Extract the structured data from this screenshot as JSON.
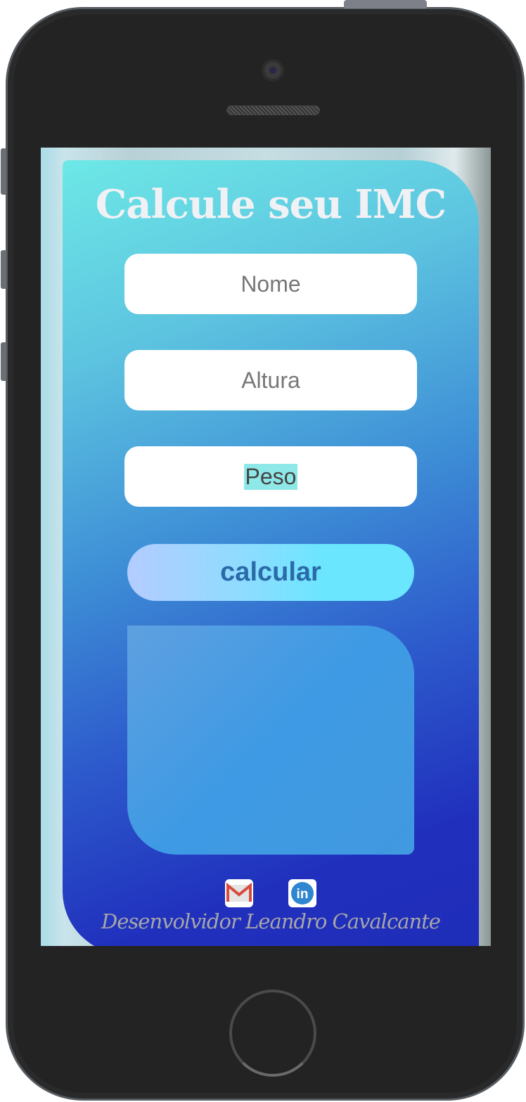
{
  "app": {
    "title": "Calcule seu IMC"
  },
  "form": {
    "name_placeholder": "Nome",
    "height_placeholder": "Altura",
    "weight_placeholder": "Peso",
    "submit_label": "calcular"
  },
  "result": {
    "text": ""
  },
  "footer": {
    "credit": "Desenvolvidor Leandro Cavalcante",
    "links": [
      {
        "icon": "gmail-icon"
      },
      {
        "icon": "linkedin-icon"
      }
    ]
  },
  "colors": {
    "accent": "#2a6aa8",
    "gmail": "#d94a3d",
    "linkedin": "#2f86d0"
  }
}
